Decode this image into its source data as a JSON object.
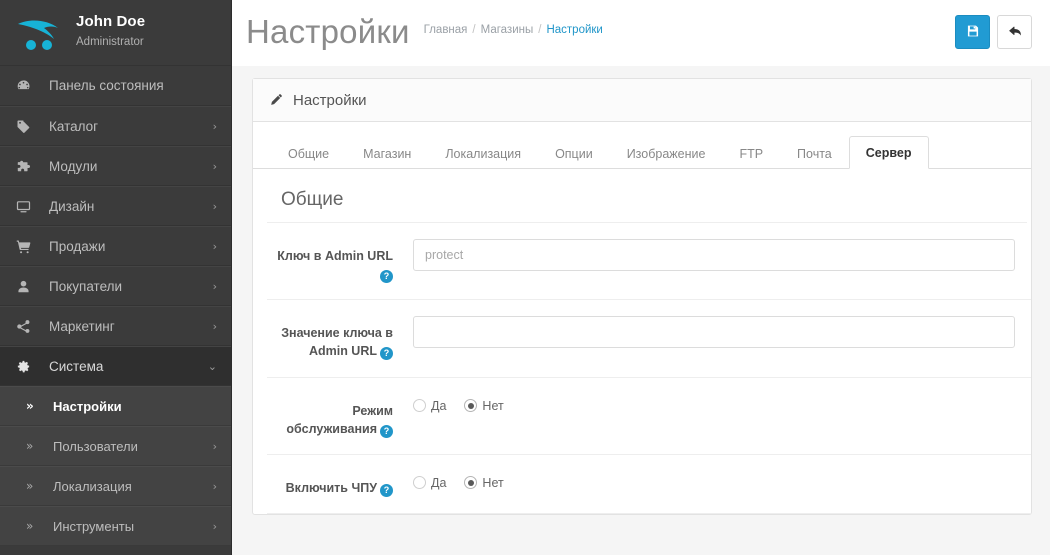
{
  "sidebar": {
    "profile": {
      "name": "John Doe",
      "role": "Administrator",
      "logo_icon": "opencart-logo-icon"
    },
    "items": [
      {
        "label": "Панель состояния",
        "icon": "dashboard-gauge-icon",
        "caret": "",
        "state": "normal"
      },
      {
        "label": "Каталог",
        "icon": "tag-icon",
        "caret": "›",
        "state": "normal"
      },
      {
        "label": "Модули",
        "icon": "puzzle-piece-icon",
        "caret": "›",
        "state": "normal"
      },
      {
        "label": "Дизайн",
        "icon": "desktop-monitor-icon",
        "caret": "›",
        "state": "normal"
      },
      {
        "label": "Продажи",
        "icon": "shopping-cart-icon",
        "caret": "›",
        "state": "normal"
      },
      {
        "label": "Покупатели",
        "icon": "user-icon",
        "caret": "›",
        "state": "normal"
      },
      {
        "label": "Маркетинг",
        "icon": "share-nodes-icon",
        "caret": "›",
        "state": "normal"
      },
      {
        "label": "Система",
        "icon": "gear-icon",
        "caret": "⌄",
        "state": "open"
      }
    ],
    "subitems": [
      {
        "label": "Настройки",
        "icon": "chevron-double-right-icon",
        "caret": "",
        "state": "active"
      },
      {
        "label": "Пользователи",
        "icon": "chevron-double-right-icon",
        "caret": "›",
        "state": "normal"
      },
      {
        "label": "Локализация",
        "icon": "chevron-double-right-icon",
        "caret": "›",
        "state": "normal"
      },
      {
        "label": "Инструменты",
        "icon": "chevron-double-right-icon",
        "caret": "›",
        "state": "normal"
      }
    ]
  },
  "header": {
    "title": "Настройки",
    "breadcrumb": [
      {
        "label": "Главная",
        "current": false
      },
      {
        "label": "Магазины",
        "current": false
      },
      {
        "label": "Настройки",
        "current": true
      }
    ],
    "breadcrumb_separator": "/",
    "actions": {
      "save": {
        "label": "",
        "icon": "floppy-disk-save-icon",
        "color": "#219bd3"
      },
      "back": {
        "label": "",
        "icon": "back-arrow-icon",
        "color": "#ffffff"
      }
    }
  },
  "panel": {
    "header_title": "Настройки",
    "header_icon": "pencil-edit-icon",
    "tabs": [
      {
        "label": "Общие",
        "active": false
      },
      {
        "label": "Магазин",
        "active": false
      },
      {
        "label": "Локализация",
        "active": false
      },
      {
        "label": "Опции",
        "active": false
      },
      {
        "label": "Изображение",
        "active": false
      },
      {
        "label": "FTP",
        "active": false
      },
      {
        "label": "Почта",
        "active": false
      },
      {
        "label": "Сервер",
        "active": true
      }
    ],
    "section_title": "Общие",
    "fields": [
      {
        "label": "Ключ в Admin URL",
        "help_icon": "question-help-icon",
        "type": "text",
        "value": "",
        "placeholder": "protect"
      },
      {
        "label": "Значение ключа в Admin URL",
        "help_icon": "question-help-icon",
        "type": "text",
        "value": "",
        "placeholder": ""
      },
      {
        "label": "Режим обслуживания",
        "help_icon": "question-help-icon",
        "type": "radio",
        "options": [
          {
            "label": "Да",
            "checked": false
          },
          {
            "label": "Нет",
            "checked": true
          }
        ]
      },
      {
        "label": "Включить ЧПУ",
        "help_icon": "question-help-icon",
        "type": "radio",
        "options": [
          {
            "label": "Да",
            "checked": false
          },
          {
            "label": "Нет",
            "checked": true
          }
        ]
      }
    ]
  },
  "colors": {
    "accent_blue": "#219bd3",
    "link_blue": "#2196c9",
    "sidebar_bg": "#3b3b3b",
    "sidebar_sub_bg": "#434343",
    "page_bg": "#f5f5f5",
    "logo_cyan": "#17b3d6"
  }
}
